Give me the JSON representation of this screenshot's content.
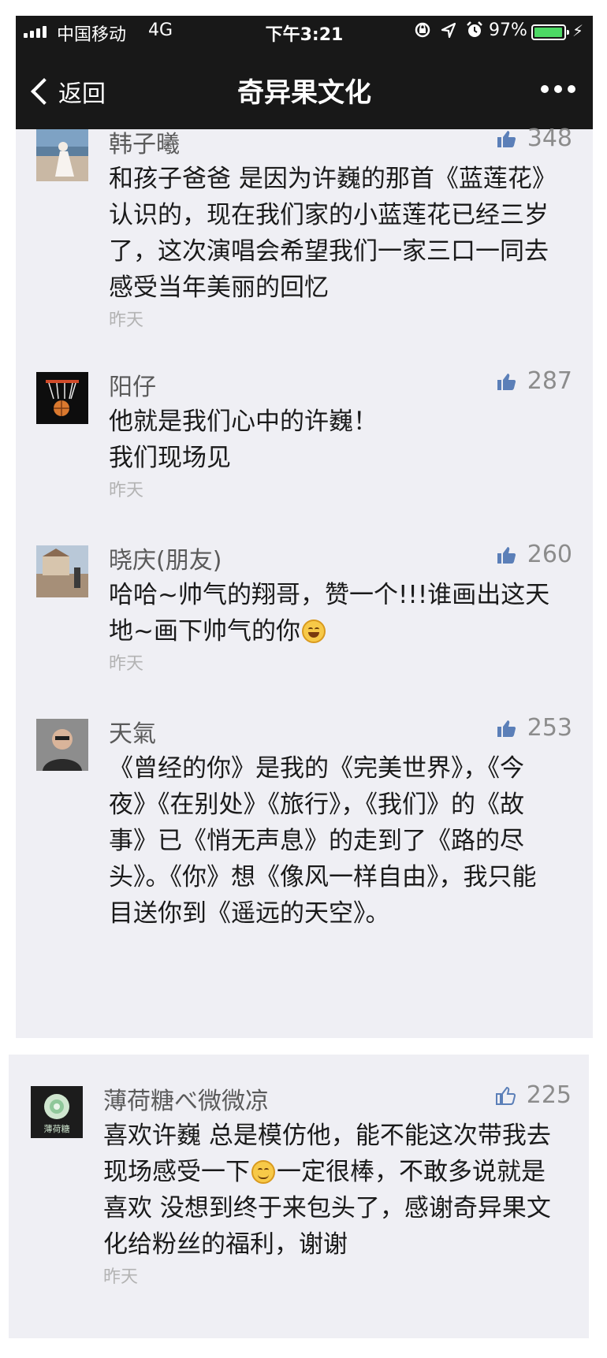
{
  "status_bar": {
    "carrier": "中国移动",
    "network": "4G",
    "time": "下午3:21",
    "battery_percent": "97%",
    "battery_level": 0.97,
    "icons": [
      "orientation-lock-icon",
      "location-arrow-icon",
      "alarm-icon",
      "charging-bolt-icon"
    ]
  },
  "nav": {
    "back_label": "返回",
    "title": "奇异果文化",
    "more_icon": "more-dots-icon"
  },
  "comments": [
    {
      "name": "韩子曦",
      "likes": "348",
      "text": "和孩子爸爸 是因为许巍的那首《蓝莲花》认识的，现在我们家的小蓝莲花已经三岁了，这次演唱会希望我们一家三口一同去感受当年美丽的回忆",
      "time": "昨天",
      "liked": true
    },
    {
      "name": "阳仔",
      "likes": "287",
      "text_lines": [
        "他就是我们心中的许巍！",
        "我们现场见"
      ],
      "time": "昨天",
      "liked": true
    },
    {
      "name": "晓庆(朋友)",
      "likes": "260",
      "text": "哈哈~帅气的翔哥，赞一个!!!谁画出这天地~画下帅气的你",
      "emoji": "grinning-face-emoji",
      "time": "昨天",
      "liked": true
    },
    {
      "name": "天氣",
      "likes": "253",
      "text": "《曾经的你》是我的《完美世界》，《今夜》《在别处》《旅行》，《我们》的《故事》已《悄无声息》的走到了《路的尽头》。《你》想《像风一样自由》，我只能目送你到《遥远的天空》。",
      "liked": true
    }
  ],
  "card2": {
    "avatar_label": "薄荷糖",
    "name": "薄荷糖べ微微凉",
    "likes": "225",
    "text_part1": "喜欢许巍 总是模仿他，能不能这次带我去现场感受一下",
    "emoji": "smiling-face-emoji",
    "text_part2": "一定很棒，不敢多说就是喜欢 没想到终于来包头了，感谢奇异果文化给粉丝的福利，谢谢",
    "time": "昨天",
    "liked": false
  },
  "colors": {
    "nav_bg": "#181818",
    "page_bg": "#efeff4",
    "thumb_filled": "#5b7fb8",
    "battery": "#4cd964"
  }
}
